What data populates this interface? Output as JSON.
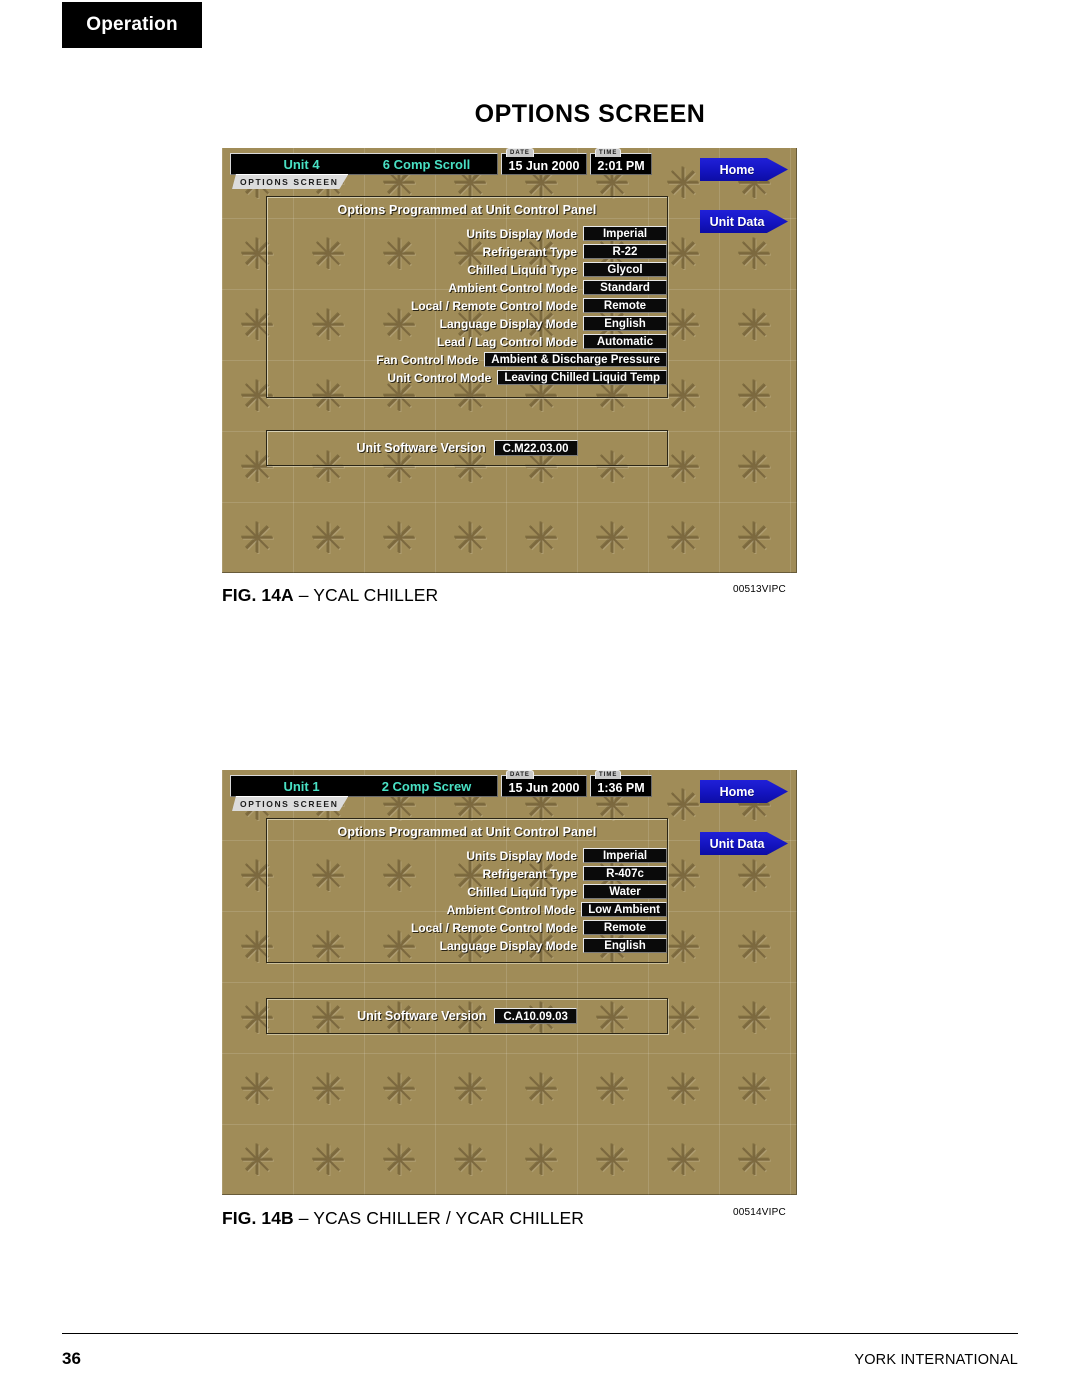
{
  "header": {
    "section_tab": "Operation",
    "page_title": "OPTIONS SCREEN"
  },
  "footer": {
    "page_number": "36",
    "company": "YORK INTERNATIONAL"
  },
  "figures": [
    {
      "caption_bold": "FIG. 14A",
      "caption_rest": "– YCAL CHILLER",
      "code": "00513VIPC",
      "screen": {
        "unit": "Unit 4",
        "model": "6 Comp Scroll",
        "date_tag": "DATE",
        "date": "15 Jun 2000",
        "time_tag": "TIME",
        "time": "2:01 PM",
        "screen_tab": "OPTIONS SCREEN",
        "buttons": [
          "Home",
          "Unit Data"
        ],
        "panel_title": "Options Programmed at Unit Control Panel",
        "options": [
          {
            "label": "Units Display Mode",
            "value": "Imperial"
          },
          {
            "label": "Refrigerant Type",
            "value": "R-22"
          },
          {
            "label": "Chilled Liquid Type",
            "value": "Glycol"
          },
          {
            "label": "Ambient Control Mode",
            "value": "Standard"
          },
          {
            "label": "Local / Remote Control Mode",
            "value": "Remote"
          },
          {
            "label": "Language Display Mode",
            "value": "English"
          },
          {
            "label": "Lead / Lag Control Mode",
            "value": "Automatic"
          },
          {
            "label": "Fan Control Mode",
            "value": "Ambient & Discharge Pressure"
          },
          {
            "label": "Unit Control Mode",
            "value": "Leaving Chilled Liquid Temp"
          }
        ],
        "version_label": "Unit Software Version",
        "version_value": "C.M22.03.00"
      }
    },
    {
      "caption_bold": "FIG. 14B",
      "caption_rest": "– YCAS CHILLER / YCAR CHILLER",
      "code": "00514VIPC",
      "screen": {
        "unit": "Unit 1",
        "model": "2 Comp Screw",
        "date_tag": "DATE",
        "date": "15 Jun 2000",
        "time_tag": "TIME",
        "time": "1:36 PM",
        "screen_tab": "OPTIONS SCREEN",
        "buttons": [
          "Home",
          "Unit Data"
        ],
        "panel_title": "Options Programmed at Unit Control Panel",
        "options": [
          {
            "label": "Units Display Mode",
            "value": "Imperial"
          },
          {
            "label": "Refrigerant Type",
            "value": "R-407c"
          },
          {
            "label": "Chilled Liquid Type",
            "value": "Water"
          },
          {
            "label": "Ambient Control Mode",
            "value": "Low Ambient"
          },
          {
            "label": "Local / Remote Control Mode",
            "value": "Remote"
          },
          {
            "label": "Language Display Mode",
            "value": "English"
          }
        ],
        "version_label": "Unit Software Version",
        "version_value": "C.A10.09.03"
      }
    }
  ],
  "colors": {
    "screen_background": "#a08c58",
    "status_text": "#49e0c4",
    "button_blue": "#1414c0",
    "value_box": "#0a0a0a"
  },
  "icons": {
    "snowflake": "✳"
  }
}
